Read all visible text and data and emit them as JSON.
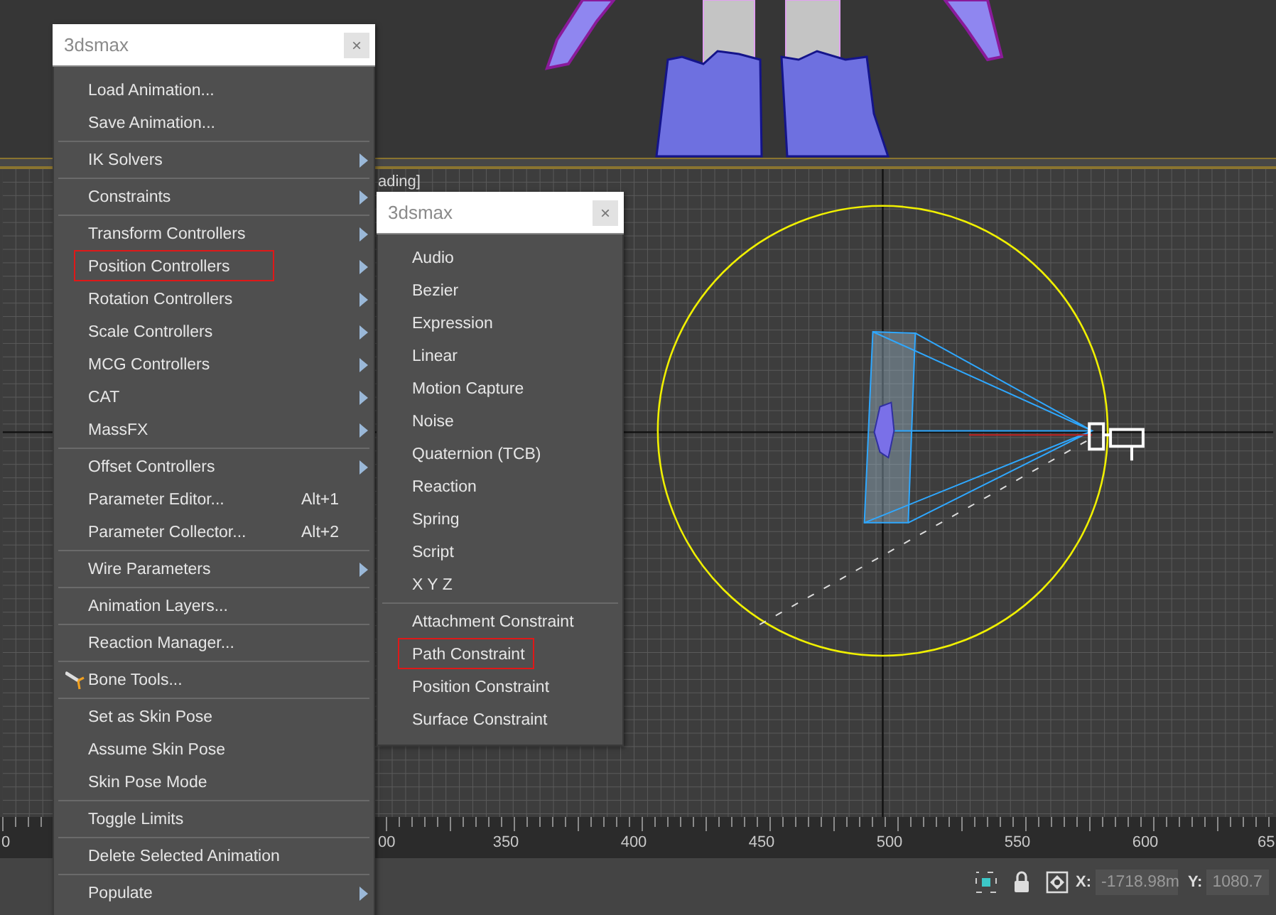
{
  "viewport": {
    "label": "ading]"
  },
  "timeline": {
    "labels": [
      "0",
      "00",
      "350",
      "400",
      "450",
      "500",
      "550",
      "600",
      "65"
    ]
  },
  "status_bar": {
    "x_label": "X:",
    "x_value": "-1718.98m",
    "y_label": "Y:",
    "y_value": "1080.7"
  },
  "main_menu": {
    "title": "3dsmax",
    "close": "×",
    "items": [
      {
        "kind": "item",
        "label": "Load Animation...",
        "submenu": false,
        "highlighted": false
      },
      {
        "kind": "item",
        "label": "Save Animation...",
        "submenu": false,
        "highlighted": false
      },
      {
        "kind": "separator"
      },
      {
        "kind": "item",
        "label": "IK Solvers",
        "submenu": true,
        "highlighted": false
      },
      {
        "kind": "separator"
      },
      {
        "kind": "item",
        "label": "Constraints",
        "submenu": true,
        "highlighted": false
      },
      {
        "kind": "separator"
      },
      {
        "kind": "item",
        "label": "Transform Controllers",
        "submenu": true,
        "highlighted": false
      },
      {
        "kind": "item",
        "label": "Position Controllers",
        "submenu": true,
        "highlighted": true
      },
      {
        "kind": "item",
        "label": "Rotation Controllers",
        "submenu": true,
        "highlighted": false
      },
      {
        "kind": "item",
        "label": "Scale Controllers",
        "submenu": true,
        "highlighted": false
      },
      {
        "kind": "item",
        "label": "MCG Controllers",
        "submenu": true,
        "highlighted": false
      },
      {
        "kind": "item",
        "label": "CAT",
        "submenu": true,
        "highlighted": false
      },
      {
        "kind": "item",
        "label": "MassFX",
        "submenu": true,
        "highlighted": false
      },
      {
        "kind": "separator"
      },
      {
        "kind": "item",
        "label": "Offset Controllers",
        "submenu": true,
        "highlighted": false
      },
      {
        "kind": "item",
        "label": "Parameter Editor...",
        "shortcut": "Alt+1",
        "submenu": false,
        "highlighted": false
      },
      {
        "kind": "item",
        "label": "Parameter Collector...",
        "shortcut": "Alt+2",
        "submenu": false,
        "highlighted": false
      },
      {
        "kind": "separator"
      },
      {
        "kind": "item",
        "label": "Wire Parameters",
        "submenu": true,
        "highlighted": false
      },
      {
        "kind": "separator"
      },
      {
        "kind": "item",
        "label": "Animation Layers...",
        "submenu": false,
        "highlighted": false
      },
      {
        "kind": "separator"
      },
      {
        "kind": "item",
        "label": "Reaction Manager...",
        "submenu": false,
        "highlighted": false
      },
      {
        "kind": "separator"
      },
      {
        "kind": "tool_item",
        "label": "Bone Tools...",
        "submenu": false,
        "highlighted": false
      },
      {
        "kind": "separator"
      },
      {
        "kind": "item",
        "label": "Set as Skin Pose",
        "submenu": false,
        "highlighted": false
      },
      {
        "kind": "item",
        "label": "Assume Skin Pose",
        "submenu": false,
        "highlighted": false
      },
      {
        "kind": "item",
        "label": "Skin Pose Mode",
        "submenu": false,
        "highlighted": false
      },
      {
        "kind": "separator"
      },
      {
        "kind": "item",
        "label": "Toggle Limits",
        "submenu": false,
        "highlighted": false
      },
      {
        "kind": "separator"
      },
      {
        "kind": "item",
        "label": "Delete Selected Animation",
        "submenu": false,
        "highlighted": false
      },
      {
        "kind": "separator"
      },
      {
        "kind": "item",
        "label": "Populate",
        "submenu": true,
        "highlighted": false
      }
    ]
  },
  "sub_menu": {
    "title": "3dsmax",
    "close": "×",
    "items": [
      {
        "kind": "item",
        "label": "Audio",
        "submenu": false,
        "highlighted": false
      },
      {
        "kind": "item",
        "label": "Bezier",
        "submenu": false,
        "highlighted": false
      },
      {
        "kind": "item",
        "label": "Expression",
        "submenu": false,
        "highlighted": false
      },
      {
        "kind": "item",
        "label": "Linear",
        "submenu": false,
        "highlighted": false
      },
      {
        "kind": "item",
        "label": "Motion Capture",
        "submenu": false,
        "highlighted": false
      },
      {
        "kind": "item",
        "label": "Noise",
        "submenu": false,
        "highlighted": false
      },
      {
        "kind": "item",
        "label": "Quaternion (TCB)",
        "submenu": false,
        "highlighted": false
      },
      {
        "kind": "item",
        "label": "Reaction",
        "submenu": false,
        "highlighted": false
      },
      {
        "kind": "item",
        "label": "Spring",
        "submenu": false,
        "highlighted": false
      },
      {
        "kind": "item",
        "label": "Script",
        "submenu": false,
        "highlighted": false
      },
      {
        "kind": "item",
        "label": "X Y Z",
        "submenu": false,
        "highlighted": false
      },
      {
        "kind": "separator"
      },
      {
        "kind": "item",
        "label": "Attachment Constraint",
        "submenu": false,
        "highlighted": false
      },
      {
        "kind": "item",
        "label": "Path Constraint",
        "submenu": false,
        "highlighted": true
      },
      {
        "kind": "item",
        "label": "Position Constraint",
        "submenu": false,
        "highlighted": false
      },
      {
        "kind": "item",
        "label": "Surface Constraint",
        "submenu": false,
        "highlighted": false
      }
    ]
  }
}
